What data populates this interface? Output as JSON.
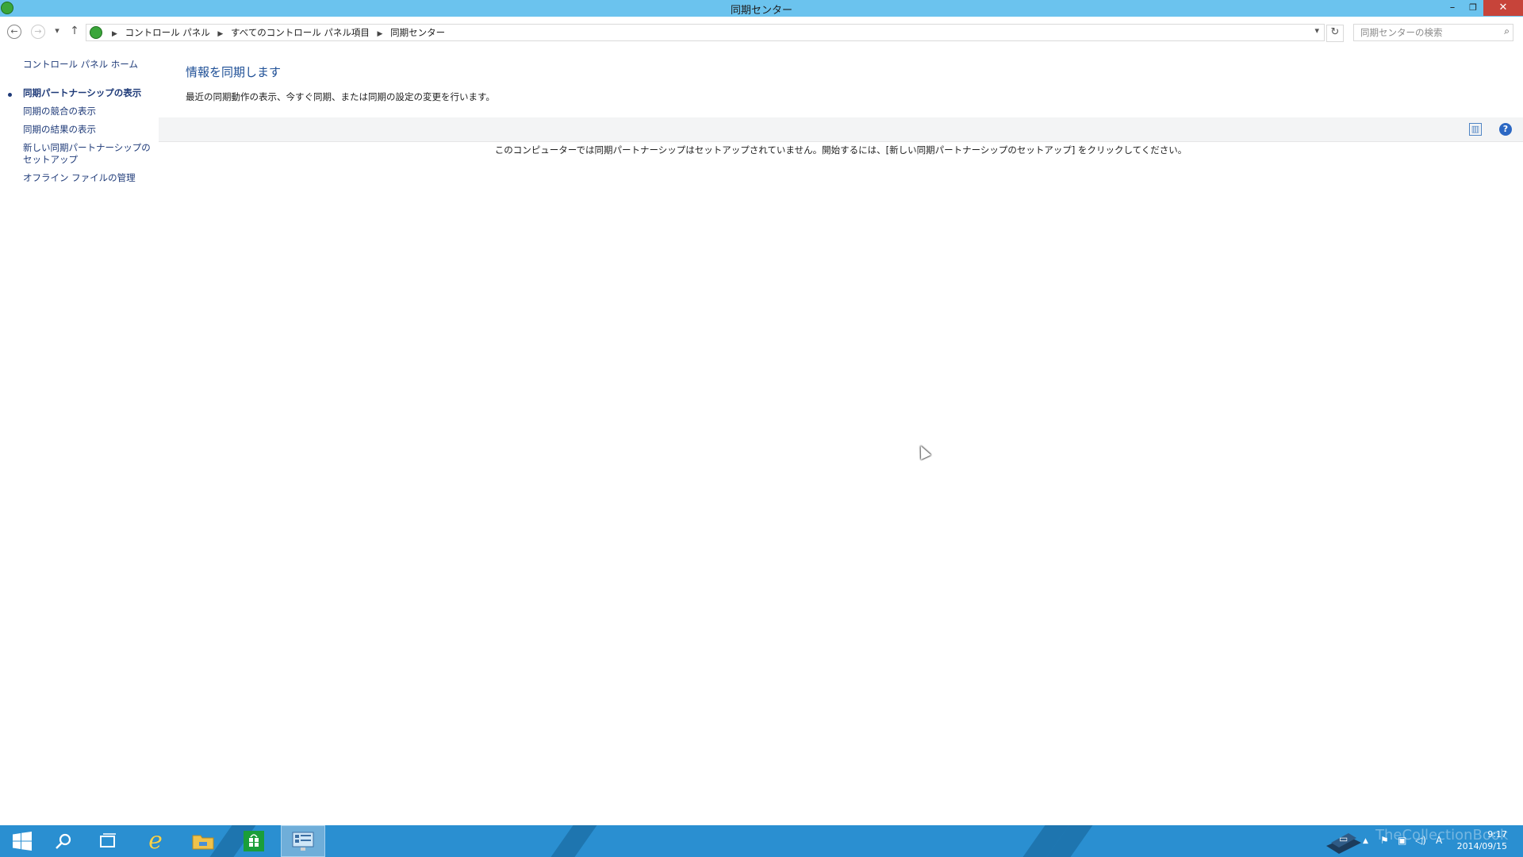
{
  "window": {
    "title": "同期センター",
    "minimize_glyph": "–",
    "maximize_glyph": "❐",
    "close_glyph": "✕"
  },
  "nav": {
    "back_glyph": "←",
    "forward_glyph": "→",
    "recent_glyph": "▾",
    "up_glyph": "↑",
    "breadcrumbs": [
      "コントロール パネル",
      "すべてのコントロール パネル項目",
      "同期センター"
    ],
    "refresh_glyph": "↻",
    "search_placeholder": "同期センターの検索"
  },
  "sidebar": {
    "home_label": "コントロール パネル ホーム",
    "items": [
      {
        "label": "同期パートナーシップの表示",
        "active": true
      },
      {
        "label": "同期の競合の表示",
        "active": false
      },
      {
        "label": "同期の結果の表示",
        "active": false
      },
      {
        "label": "新しい同期パートナーシップのセットアップ",
        "active": false
      },
      {
        "label": "オフライン ファイルの管理",
        "active": false
      }
    ]
  },
  "main": {
    "title": "情報を同期します",
    "description": "最近の同期動作の表示、今すぐ同期、または同期の設定の変更を行います。",
    "empty_message": "このコンピューターでは同期パートナーシップはセットアップされていません。開始するには、[新しい同期パートナーシップのセットアップ] をクリックしてください。",
    "help_glyph": "?"
  },
  "taskbar": {
    "apps": [
      "start-icon",
      "search-icon",
      "task-view-icon",
      "internet-explorer-icon",
      "file-explorer-icon",
      "store-icon",
      "control-panel-icon"
    ],
    "tray_input_indicator": "A",
    "time": "9:17",
    "date": "2014/09/15",
    "watermark": "TheCollectionBook"
  },
  "colors": {
    "titlebar": "#6bc3ee",
    "taskbar": "#2a8fd1",
    "link": "#1e3a78",
    "heading": "#1e4f96",
    "close": "#c7443a"
  }
}
